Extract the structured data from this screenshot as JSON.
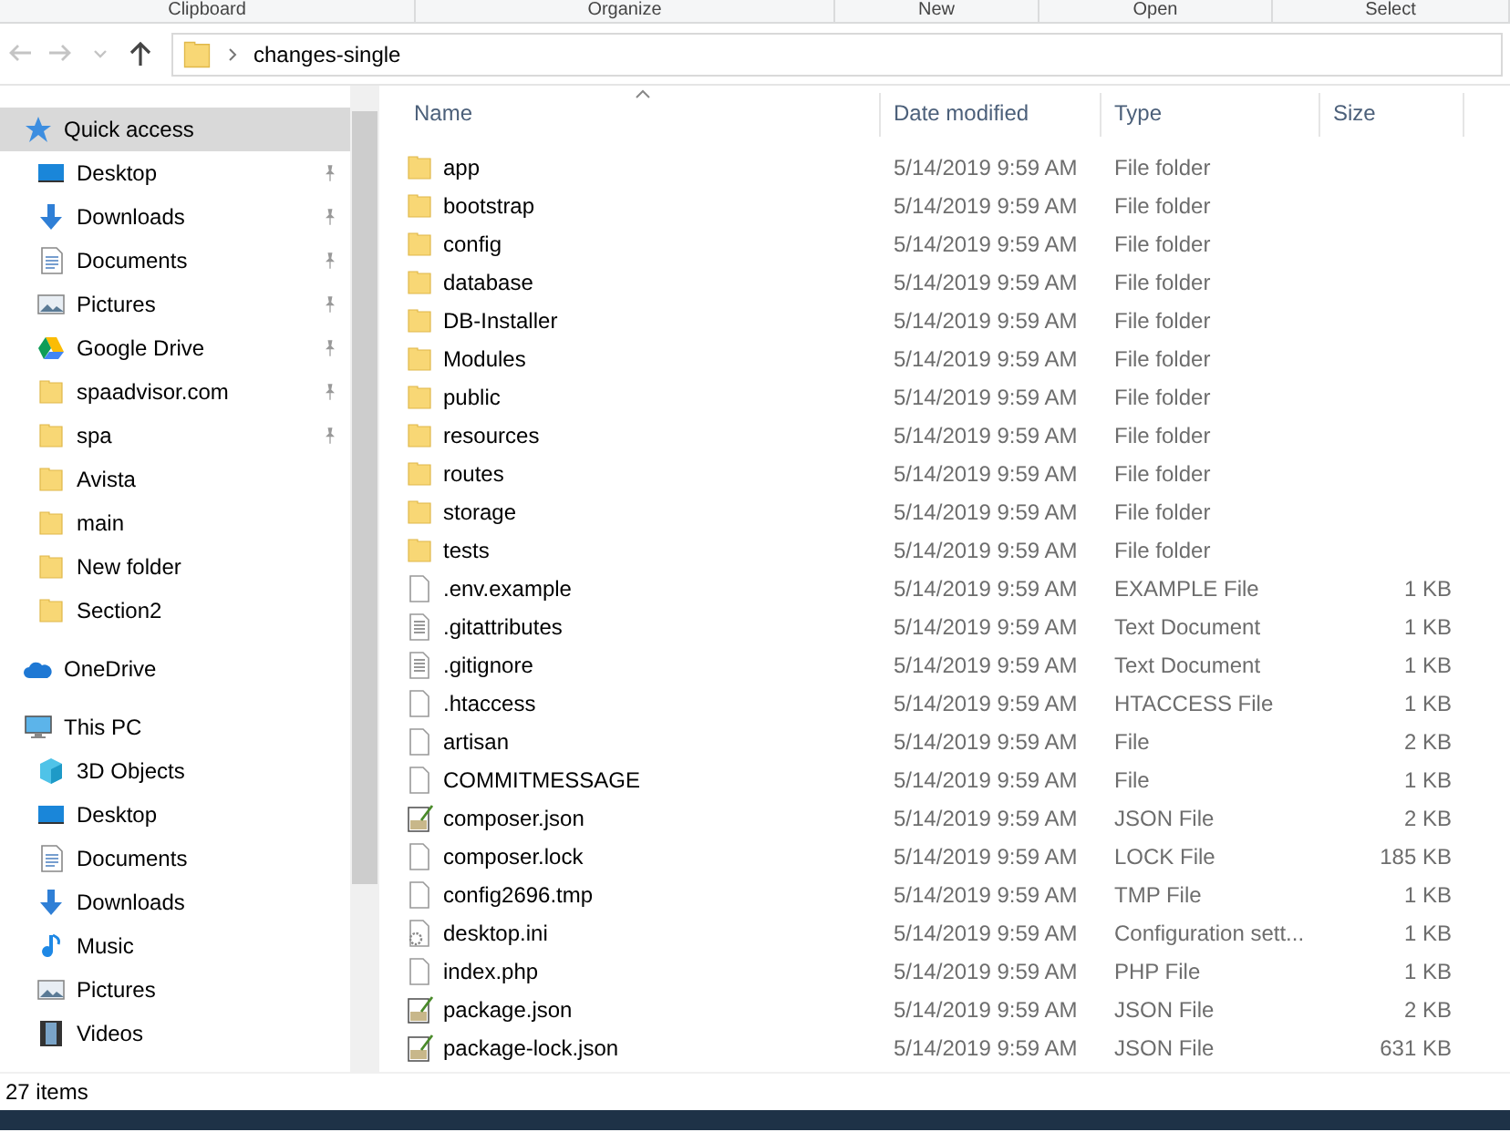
{
  "ribbon_groups": [
    "Clipboard",
    "Organize",
    "New",
    "Open",
    "Select"
  ],
  "address": {
    "path": "changes-single"
  },
  "nav": [
    {
      "label": "Quick access",
      "kind": "star",
      "selected": true,
      "children": [
        {
          "label": "Desktop",
          "kind": "desktop",
          "pinned": true,
          "selected": false
        },
        {
          "label": "Downloads",
          "kind": "download",
          "pinned": true,
          "selected": false
        },
        {
          "label": "Documents",
          "kind": "document",
          "pinned": true,
          "selected": false
        },
        {
          "label": "Pictures",
          "kind": "picture",
          "pinned": true,
          "selected": false
        },
        {
          "label": "Google Drive",
          "kind": "drive",
          "pinned": true,
          "selected": false
        },
        {
          "label": "spaadvisor.com",
          "kind": "folder",
          "pinned": true,
          "selected": false
        },
        {
          "label": "spa",
          "kind": "folder",
          "pinned": true,
          "selected": false
        },
        {
          "label": "Avista",
          "kind": "folder",
          "pinned": false,
          "selected": false
        },
        {
          "label": "main",
          "kind": "folder",
          "pinned": false,
          "selected": false
        },
        {
          "label": "New folder",
          "kind": "folder",
          "pinned": false,
          "selected": false
        },
        {
          "label": "Section2",
          "kind": "folder",
          "pinned": false,
          "selected": false
        }
      ]
    },
    {
      "label": "OneDrive",
      "kind": "cloud",
      "selected": false
    },
    {
      "label": "This PC",
      "kind": "pc",
      "selected": false,
      "children": [
        {
          "label": "3D Objects",
          "kind": "cube",
          "pinned": false,
          "selected": false
        },
        {
          "label": "Desktop",
          "kind": "desktop",
          "pinned": false,
          "selected": false
        },
        {
          "label": "Documents",
          "kind": "document",
          "pinned": false,
          "selected": false
        },
        {
          "label": "Downloads",
          "kind": "download",
          "pinned": false,
          "selected": false
        },
        {
          "label": "Music",
          "kind": "music",
          "pinned": false,
          "selected": false
        },
        {
          "label": "Pictures",
          "kind": "picture",
          "pinned": false,
          "selected": false
        },
        {
          "label": "Videos",
          "kind": "video",
          "pinned": false,
          "selected": false
        }
      ]
    }
  ],
  "columns": [
    {
      "label": "Name",
      "sorted": true
    },
    {
      "label": "Date modified",
      "sorted": false
    },
    {
      "label": "Type",
      "sorted": false
    },
    {
      "label": "Size",
      "sorted": false
    }
  ],
  "files": [
    {
      "kind": "folder",
      "name": "app",
      "date": "5/14/2019 9:59 AM",
      "type": "File folder"
    },
    {
      "kind": "folder",
      "name": "bootstrap",
      "date": "5/14/2019 9:59 AM",
      "type": "File folder"
    },
    {
      "kind": "folder",
      "name": "config",
      "date": "5/14/2019 9:59 AM",
      "type": "File folder"
    },
    {
      "kind": "folder",
      "name": "database",
      "date": "5/14/2019 9:59 AM",
      "type": "File folder"
    },
    {
      "kind": "folder",
      "name": "DB-Installer",
      "date": "5/14/2019 9:59 AM",
      "type": "File folder"
    },
    {
      "kind": "folder",
      "name": "Modules",
      "date": "5/14/2019 9:59 AM",
      "type": "File folder"
    },
    {
      "kind": "folder",
      "name": "public",
      "date": "5/14/2019 9:59 AM",
      "type": "File folder"
    },
    {
      "kind": "folder",
      "name": "resources",
      "date": "5/14/2019 9:59 AM",
      "type": "File folder"
    },
    {
      "kind": "folder",
      "name": "routes",
      "date": "5/14/2019 9:59 AM",
      "type": "File folder"
    },
    {
      "kind": "folder",
      "name": "storage",
      "date": "5/14/2019 9:59 AM",
      "type": "File folder"
    },
    {
      "kind": "folder",
      "name": "tests",
      "date": "5/14/2019 9:59 AM",
      "type": "File folder"
    },
    {
      "kind": "blank",
      "name": ".env.example",
      "date": "5/14/2019 9:59 AM",
      "type": "EXAMPLE File",
      "size": "1 KB"
    },
    {
      "kind": "text",
      "name": ".gitattributes",
      "date": "5/14/2019 9:59 AM",
      "type": "Text Document",
      "size": "1 KB"
    },
    {
      "kind": "text",
      "name": ".gitignore",
      "date": "5/14/2019 9:59 AM",
      "type": "Text Document",
      "size": "1 KB"
    },
    {
      "kind": "blank",
      "name": ".htaccess",
      "date": "5/14/2019 9:59 AM",
      "type": "HTACCESS File",
      "size": "1 KB"
    },
    {
      "kind": "blank",
      "name": "artisan",
      "date": "5/14/2019 9:59 AM",
      "type": "File",
      "size": "2 KB"
    },
    {
      "kind": "blank",
      "name": "COMMITMESSAGE",
      "date": "5/14/2019 9:59 AM",
      "type": "File",
      "size": "1 KB"
    },
    {
      "kind": "notepad",
      "name": "composer.json",
      "date": "5/14/2019 9:59 AM",
      "type": "JSON File",
      "size": "2 KB"
    },
    {
      "kind": "blank",
      "name": "composer.lock",
      "date": "5/14/2019 9:59 AM",
      "type": "LOCK File",
      "size": "185 KB"
    },
    {
      "kind": "blank",
      "name": "config2696.tmp",
      "date": "5/14/2019 9:59 AM",
      "type": "TMP File",
      "size": "1 KB"
    },
    {
      "kind": "settings",
      "name": "desktop.ini",
      "date": "5/14/2019 9:59 AM",
      "type": "Configuration sett...",
      "size": "1 KB"
    },
    {
      "kind": "blank",
      "name": "index.php",
      "date": "5/14/2019 9:59 AM",
      "type": "PHP File",
      "size": "1 KB"
    },
    {
      "kind": "notepad",
      "name": "package.json",
      "date": "5/14/2019 9:59 AM",
      "type": "JSON File",
      "size": "2 KB"
    },
    {
      "kind": "notepad",
      "name": "package-lock.json",
      "date": "5/14/2019 9:59 AM",
      "type": "JSON File",
      "size": "631 KB"
    }
  ],
  "status": "27 items"
}
